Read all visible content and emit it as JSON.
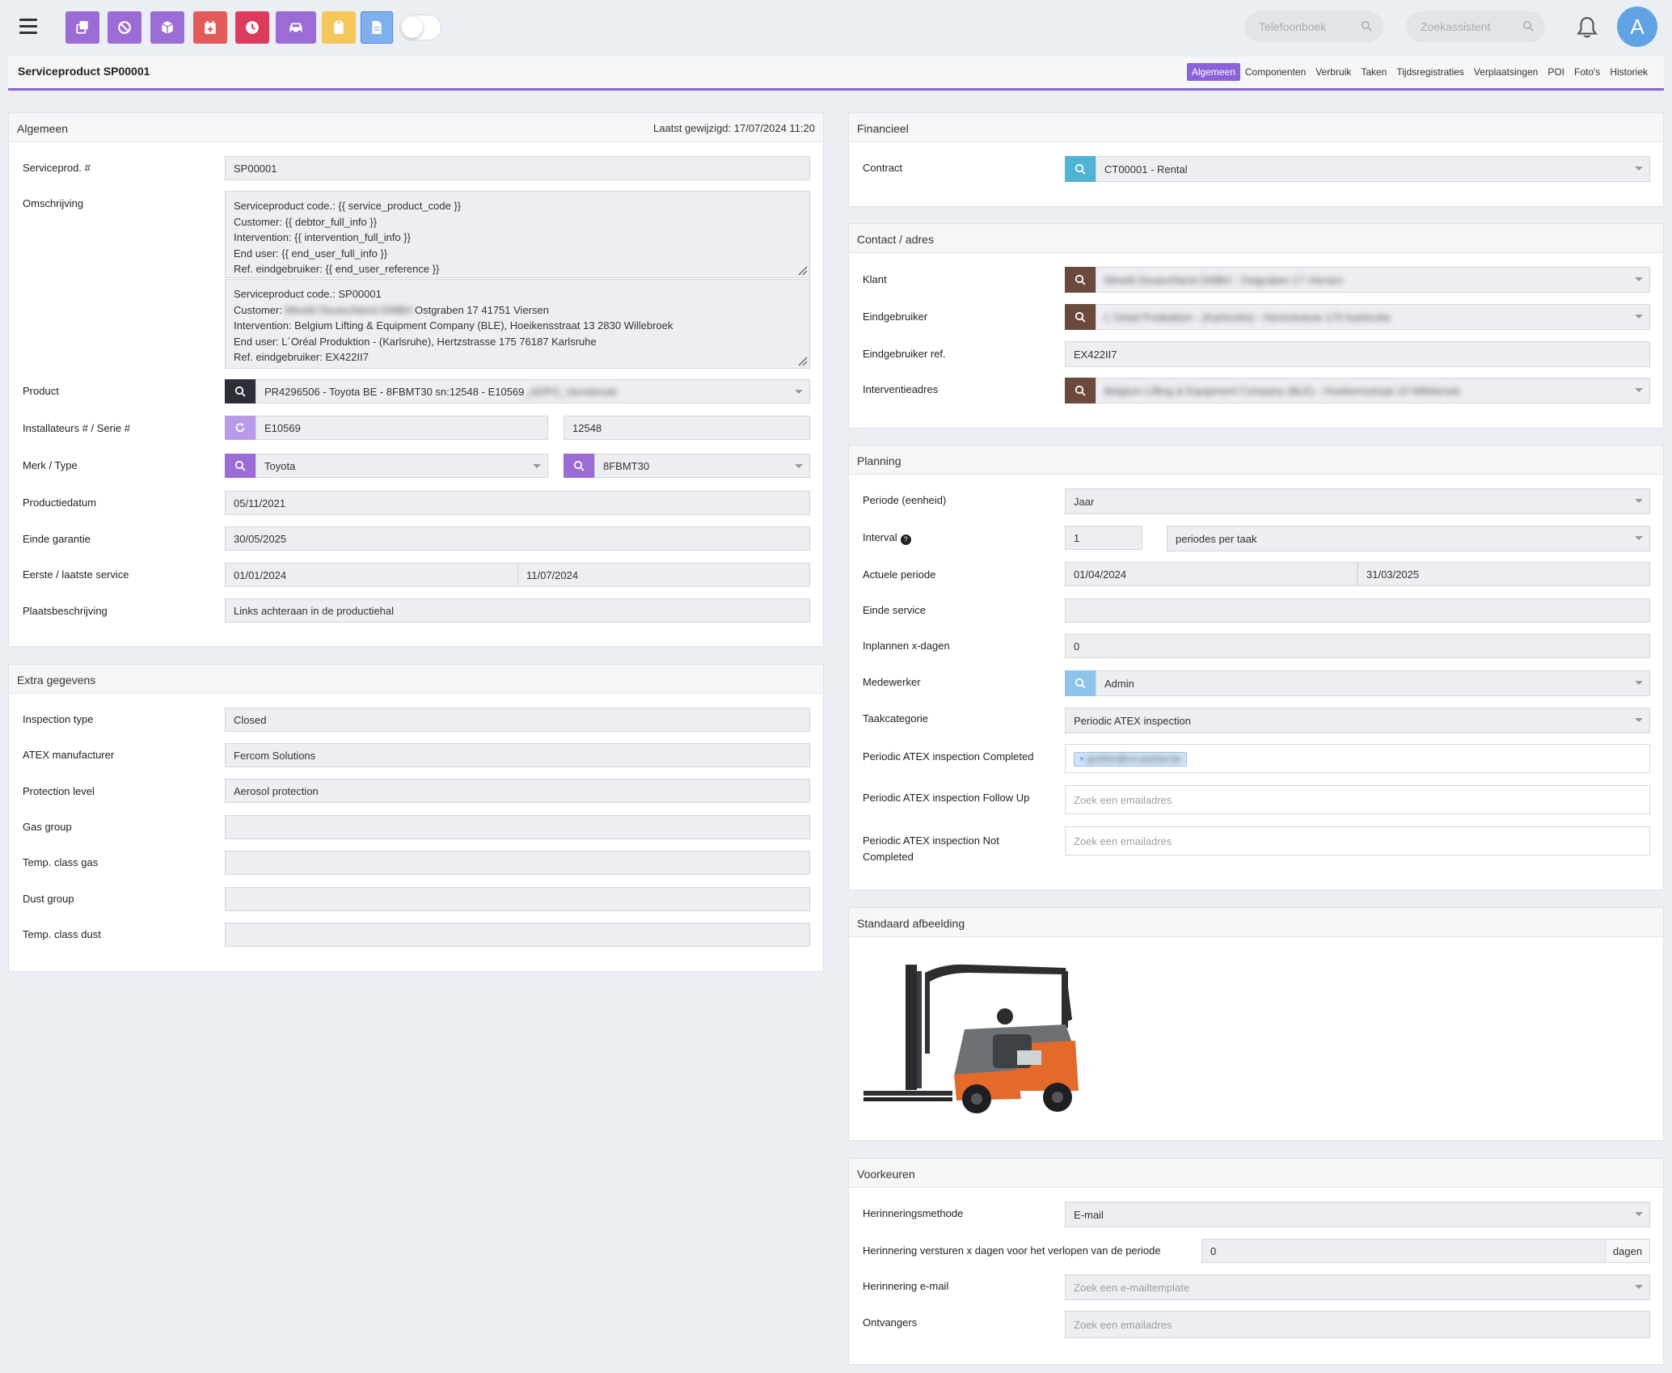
{
  "topbar": {
    "search_phone": "Telefoonboek",
    "search_assist": "Zoekassistent",
    "avatar_letter": "A",
    "buttons": [
      {
        "icon": "copy-icon",
        "color": "#9b6bd6"
      },
      {
        "icon": "ban-icon",
        "color": "#9b6bd6"
      },
      {
        "icon": "box-icon",
        "color": "#9b6bd6"
      },
      {
        "icon": "calendar-plus-icon",
        "color": "#e35a5a"
      },
      {
        "icon": "clock-icon",
        "color": "#dd3b5b"
      },
      {
        "icon": "car-icon",
        "color": "#9b6bd6"
      },
      {
        "icon": "clipboard-icon",
        "color": "#f5c75a"
      },
      {
        "icon": "document-icon",
        "color": "#7fb1ee"
      }
    ]
  },
  "header": {
    "title": "Serviceproduct SP00001",
    "tabs": [
      "Algemeen",
      "Componenten",
      "Verbruik",
      "Taken",
      "Tijdsregistraties",
      "Verplaatsingen",
      "POI",
      "Foto's",
      "Historiek"
    ]
  },
  "algemeen": {
    "title": "Algemeen",
    "last_modified": "Laatst gewijzigd: 17/07/2024 11:20",
    "serviceprod_label": "Serviceprod. #",
    "serviceprod_value": "SP00001",
    "omschrijving_label": "Omschrijving",
    "template_lines": [
      "Serviceproduct code.: {{ service_product_code }}",
      "Customer: {{ debtor_full_info }}",
      "Intervention: {{ intervention_full_info }}",
      "End user: {{ end_user_full_info }}",
      "Ref. eindgebruiker: {{ end_user_reference }}"
    ],
    "rendered_line1": "Serviceproduct code.: SP00001",
    "rendered_customer_prefix": "Customer: ",
    "rendered_customer_blur": "Minetti Deutschland GMBH",
    "rendered_customer_suffix": " Ostgraben 17 41751 Viersen",
    "rendered_line3": "Intervention: Belgium Lifting & Equipment Company (BLE), Hoeikensstraat 13 2830 Willebroek",
    "rendered_line4": "End user: L´Oréal Produktion - (Karlsruhe), Hertzstrasse 175 76187 Karlsruhe",
    "rendered_line5": "Ref. eindgebruiker: EX422II7",
    "product_label": "Product",
    "product_value": "PR4296506 - Toyota BE - 8FBMT30 sn:12548 - E10569",
    "product_blur": "_ADPO_Verrebroek",
    "installers_label": "Installateurs # / Serie #",
    "installer_value": "E10569",
    "serial_value": "12548",
    "brand_label": "Merk / Type",
    "brand_value": "Toyota",
    "type_value": "8FBMT30",
    "proddate_label": "Productiedatum",
    "proddate_value": "05/11/2021",
    "warranty_label": "Einde garantie",
    "warranty_value": "30/05/2025",
    "service_label": "Eerste / laatste service",
    "first_service": "01/01/2024",
    "last_service": "11/07/2024",
    "place_label": "Plaatsbeschrijving",
    "place_value": "Links achteraan in de productiehal"
  },
  "extra": {
    "title": "Extra gegevens",
    "rows": [
      {
        "label": "Inspection type",
        "value": "Closed"
      },
      {
        "label": "ATEX manufacturer",
        "value": "Fercom Solutions"
      },
      {
        "label": "Protection level",
        "value": "Aerosol protection"
      },
      {
        "label": "Gas group",
        "value": ""
      },
      {
        "label": "Temp. class gas",
        "value": ""
      },
      {
        "label": "Dust group",
        "value": ""
      },
      {
        "label": "Temp. class dust",
        "value": ""
      }
    ]
  },
  "financieel": {
    "title": "Financieel",
    "contract_label": "Contract",
    "contract_value": "CT00001 - Rental"
  },
  "contact": {
    "title": "Contact / adres",
    "klant_label": "Klant",
    "klant_blur": "Minetti Deutschland GMBH - Ostgraben 17 Viersen",
    "eind_label": "Eindgebruiker",
    "eind_blur": "L´Oréal Produktion - (Karlsruhe) - Hertzstrasse 175 Karlsruhe",
    "eindref_label": "Eindgebruiker ref.",
    "eindref_value": "EX422II7",
    "interv_label": "Interventieadres",
    "interv_blur": "Belgium Lifting & Equipment Company (BLE) - Hoeikensstraat 13 Willebroek"
  },
  "planning": {
    "title": "Planning",
    "periode_label": "Periode (eenheid)",
    "periode_value": "Jaar",
    "interval_label": "Interval",
    "interval_help": "?",
    "interval_value": "1",
    "interval_unit": "periodes per taak",
    "actueel_label": "Actuele periode",
    "actueel_start": "01/04/2024",
    "actueel_end": "31/03/2025",
    "einde_label": "Einde service",
    "einde_value": "",
    "inplannen_label": "Inplannen x-dagen",
    "inplannen_value": "0",
    "medewerker_label": "Medewerker",
    "medewerker_value": "Admin",
    "taak_label": "Taakcategorie",
    "taak_value": "Periodic ATEX inspection",
    "completed_label": "Periodic ATEX inspection Completed",
    "completed_tag_x": "×",
    "completed_tag": "gunther@ccr-partner.be",
    "followup_label": "Periodic ATEX inspection Follow Up",
    "followup_placeholder": "Zoek een emailadres",
    "notcompleted_label": "Periodic ATEX inspection Not Completed",
    "notcompleted_placeholder": "Zoek een emailadres"
  },
  "afbeelding": {
    "title": "Standaard afbeelding",
    "image_alt": "Toyota forklift"
  },
  "voorkeuren": {
    "title": "Voorkeuren",
    "methode_label": "Herinneringsmethode",
    "methode_value": "E-mail",
    "dagen_label": "Herinnering versturen x dagen voor het verlopen van de periode",
    "dagen_value": "0",
    "dagen_unit": "dagen",
    "email_label": "Herinnering e-mail",
    "email_placeholder": "Zoek een e-mailtemplate",
    "ontvangers_label": "Ontvangers",
    "ontvangers_placeholder": "Zoek een emailadres"
  }
}
